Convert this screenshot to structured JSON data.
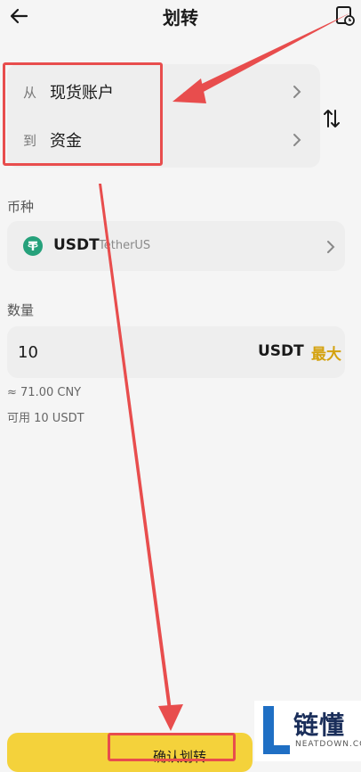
{
  "header": {
    "title": "划转",
    "back_icon": "arrow-left-icon",
    "history_icon": "document-clock-icon"
  },
  "transfer": {
    "from_label": "从",
    "from_value": "现货账户",
    "to_label": "到",
    "to_value": "资金",
    "swap_icon": "swap-vertical-icon"
  },
  "coin": {
    "section_label": "币种",
    "symbol": "USDT",
    "name": "TetherUS",
    "icon": "tether-icon"
  },
  "amount": {
    "section_label": "数量",
    "value": "10",
    "unit": "USDT",
    "max_label": "最大",
    "approx": "≈ 71.00 CNY",
    "available": "可用 10 USDT"
  },
  "confirm": {
    "label": "确认划转"
  },
  "watermark": {
    "name": "链懂",
    "sub": "NEATDOWN.COM"
  },
  "colors": {
    "accent": "#f4d23b",
    "max": "#d4a20f",
    "annotation": "#e84d4d",
    "tether": "#26a17b"
  }
}
